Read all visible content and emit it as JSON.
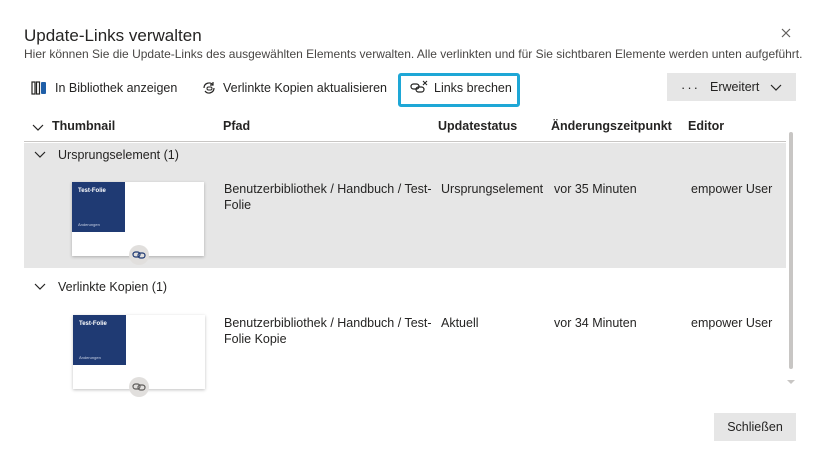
{
  "dialog": {
    "title": "Update-Links verwalten",
    "subtitle": "Hier können Sie die Update-Links des ausgewählten Elements verwalten. Alle verlinkten und für Sie sichtbaren Elemente werden unten aufgeführt."
  },
  "toolbar": {
    "show_in_library": "In Bibliothek anzeigen",
    "update_copies": "Verlinkte Kopien aktualisieren",
    "break_links": "Links brechen",
    "more_dots": "···",
    "advanced": "Erweitert"
  },
  "table": {
    "columns": {
      "thumbnail": "Thumbnail",
      "path": "Pfad",
      "status": "Updatestatus",
      "changed": "Änderungszeitpunkt",
      "editor": "Editor"
    },
    "groups": [
      {
        "label": "Ursprungselement (1)",
        "rows": [
          {
            "thumb_title": "Test-Folie",
            "thumb_sub": "Änderungen",
            "path_line1": "Benutzerbibliothek / Handbuch / Test-",
            "path_line2": "Folie",
            "status": "Ursprungselement",
            "changed": "vor 35 Minuten",
            "editor": "empower User"
          }
        ]
      },
      {
        "label": "Verlinkte Kopien (1)",
        "rows": [
          {
            "thumb_title": "Test-Folie",
            "thumb_sub": "Änderungen",
            "path_line1": "Benutzerbibliothek / Handbuch / Test-",
            "path_line2": "Folie Kopie",
            "status": "Aktuell",
            "changed": "vor 34 Minuten",
            "editor": "empower User"
          }
        ]
      }
    ]
  },
  "footer": {
    "close_label": "Schließen"
  },
  "colors": {
    "highlight": "#1ea7d6",
    "thumb_blue": "#1f3a73",
    "selected_bg": "#e6e6e6"
  }
}
